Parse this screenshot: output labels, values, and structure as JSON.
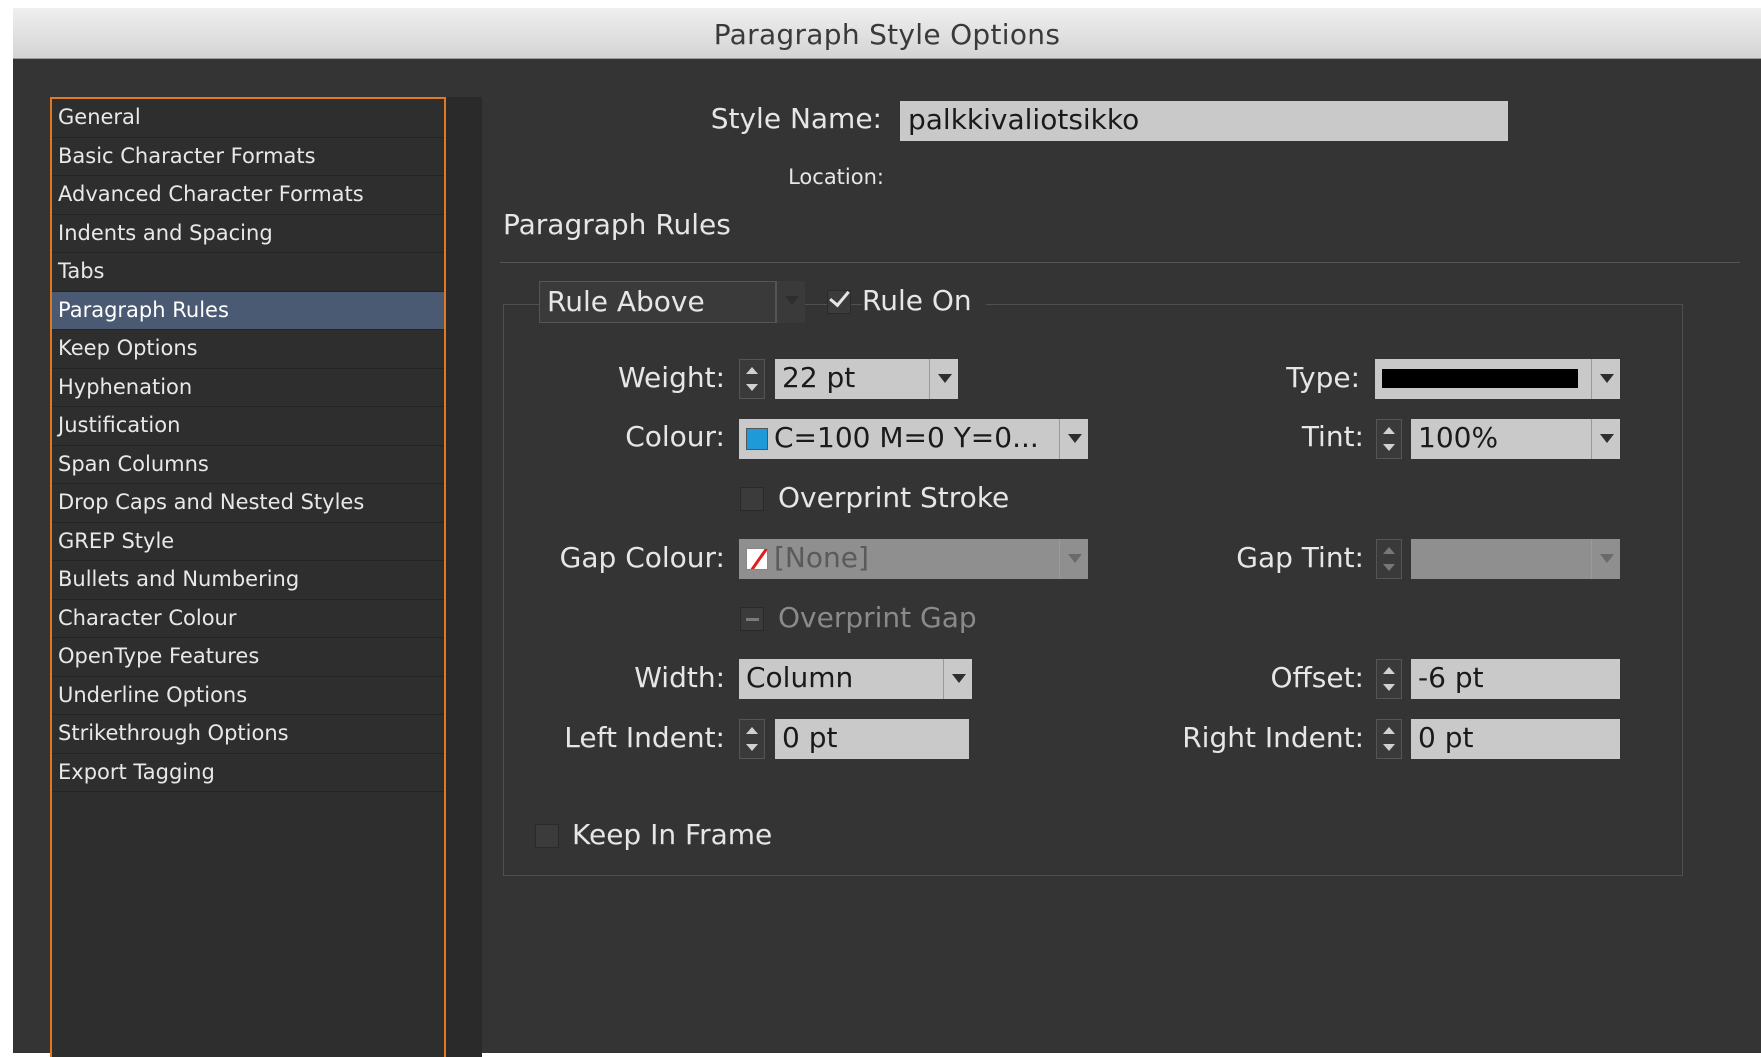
{
  "window": {
    "title": "Paragraph Style Options"
  },
  "sidebar": {
    "items": [
      {
        "label": "General"
      },
      {
        "label": "Basic Character Formats"
      },
      {
        "label": "Advanced Character Formats"
      },
      {
        "label": "Indents and Spacing"
      },
      {
        "label": "Tabs"
      },
      {
        "label": "Paragraph Rules"
      },
      {
        "label": "Keep Options"
      },
      {
        "label": "Hyphenation"
      },
      {
        "label": "Justification"
      },
      {
        "label": "Span Columns"
      },
      {
        "label": "Drop Caps and Nested Styles"
      },
      {
        "label": "GREP Style"
      },
      {
        "label": "Bullets and Numbering"
      },
      {
        "label": "Character Colour"
      },
      {
        "label": "OpenType Features"
      },
      {
        "label": "Underline Options"
      },
      {
        "label": "Strikethrough Options"
      },
      {
        "label": "Export Tagging"
      }
    ],
    "selected": "Paragraph Rules"
  },
  "header": {
    "style_name_label": "Style Name:",
    "style_name_value": "palkkivaliotsikko",
    "location_label": "Location:",
    "section_title": "Paragraph Rules"
  },
  "rules": {
    "rule_select_value": "Rule Above",
    "rule_on_label": "Rule On",
    "rule_on_checked": true,
    "weight_label": "Weight:",
    "weight_value": "22 pt",
    "type_label": "Type:",
    "colour_label": "Colour:",
    "colour_value": "C=100 M=0 Y=0...",
    "tint_label": "Tint:",
    "tint_value": "100%",
    "overprint_stroke_label": "Overprint Stroke",
    "gap_colour_label": "Gap Colour:",
    "gap_colour_value": "[None]",
    "gap_tint_label": "Gap Tint:",
    "overprint_gap_label": "Overprint Gap",
    "width_label": "Width:",
    "width_value": "Column",
    "offset_label": "Offset:",
    "offset_value": "-6 pt",
    "left_indent_label": "Left Indent:",
    "left_indent_value": "0 pt",
    "right_indent_label": "Right Indent:",
    "right_indent_value": "0 pt",
    "keep_in_frame_label": "Keep In Frame"
  },
  "colors": {
    "selection_border": "#e07a22",
    "selected_item_bg": "#4a5a72",
    "swatch_cyan": "#1f9ad9"
  }
}
